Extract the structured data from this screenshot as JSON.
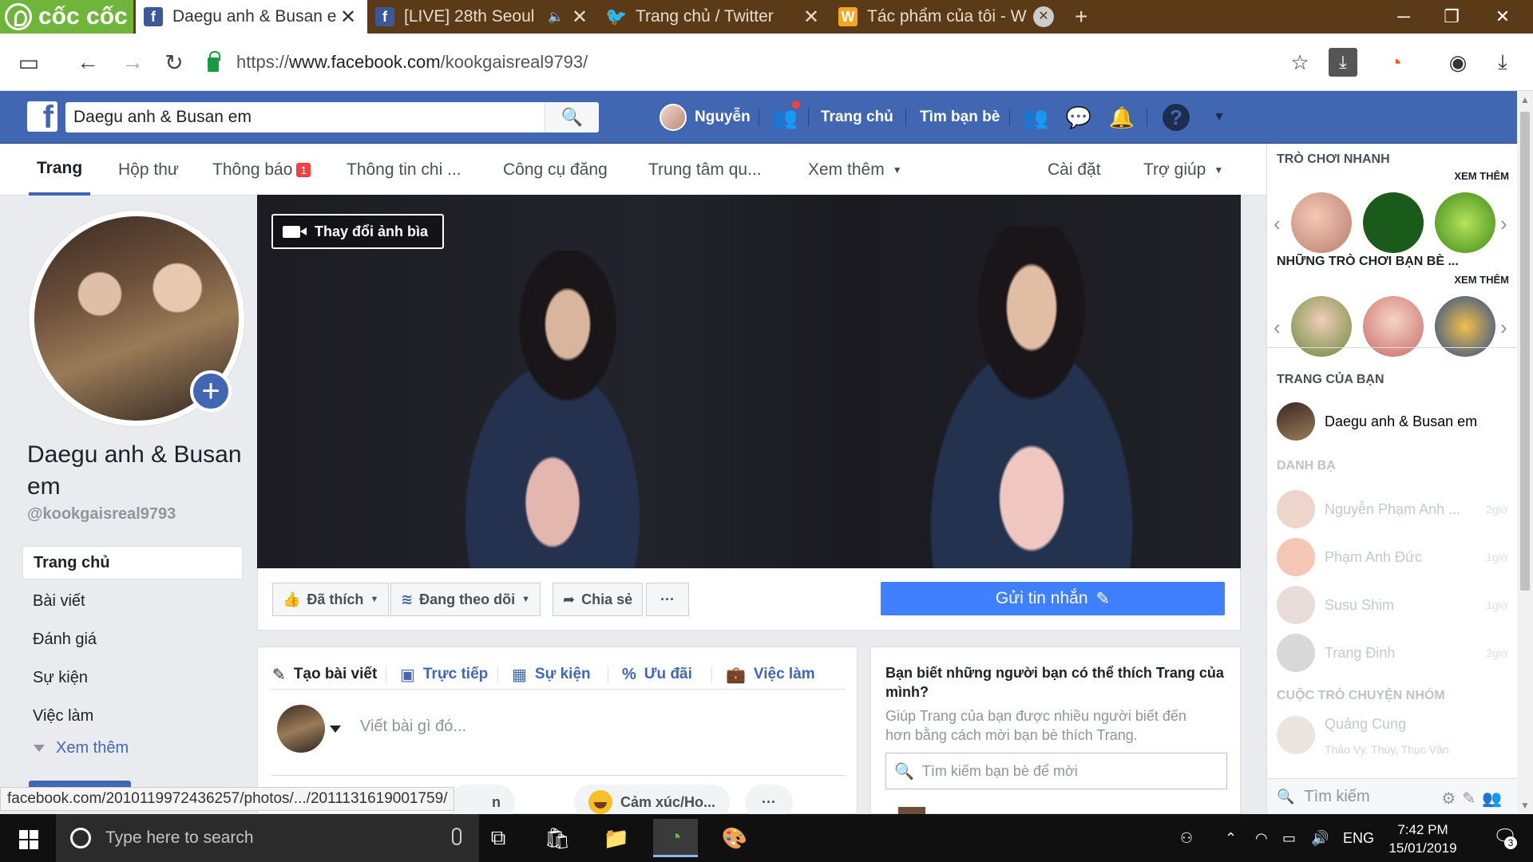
{
  "browser": {
    "brand": "cốc cốc",
    "tabs": [
      {
        "title": "Daegu anh & Busan e",
        "icon": "facebook-icon"
      },
      {
        "title": "[LIVE] 28th Seoul",
        "icon": "facebook-icon"
      },
      {
        "title": "Trang chủ / Twitter",
        "icon": "twitter-icon"
      },
      {
        "title": "Tác phẩm của tôi - W",
        "icon": "wattpad-icon"
      }
    ],
    "url_prefix": "https://",
    "url_host": "www.facebook.com",
    "url_path": "/kookgaisreal9793/",
    "status_url": "facebook.com/2010119972436257/photos/.../2011131619001759/"
  },
  "fb": {
    "search_value": "Daegu anh & Busan em",
    "user_name": "Nguyễn",
    "nav_home": "Trang chủ",
    "nav_find_friends": "Tìm bạn bè"
  },
  "page_tabs": {
    "page": "Trang",
    "inbox": "Hộp thư",
    "notifications": "Thông báo",
    "notifications_badge": "1",
    "insights": "Thông tin chi ...",
    "publishing_tools": "Công cụ đăng",
    "ads_center": "Trung tâm qu...",
    "more": "Xem thêm",
    "settings": "Cài đặt",
    "help": "Trợ giúp"
  },
  "page": {
    "name": "Daegu anh & Busan em",
    "handle": "@kookgaisreal9793",
    "left_nav": [
      "Trang chủ",
      "Bài viết",
      "Đánh giá",
      "Sự kiện",
      "Việc làm"
    ],
    "left_more": "Xem thêm",
    "cover_button": "Thay đổi ảnh bìa"
  },
  "actions": {
    "liked": "Đã thích",
    "following": "Đang theo dõi",
    "share": "Chia sẻ",
    "more": "···",
    "send_message": "Gửi tin nhắn"
  },
  "composer": {
    "tabs": [
      "Tạo bài viết",
      "Trực tiếp",
      "Sự kiện",
      "Ưu đãi",
      "Việc làm"
    ],
    "placeholder": "Viết bài gì đó...",
    "chip_partial": "n",
    "chip_feeling": "Cảm xúc/Ho...",
    "chip_more": "···"
  },
  "suggest": {
    "title": "Bạn biết những người bạn có thể thích Trang của mình?",
    "subtitle": "Giúp Trang của bạn được nhiều người biết đến hơn bằng cách mời bạn bè thích Trang.",
    "search_placeholder": "Tìm kiếm bạn bè để mời"
  },
  "sidebar": {
    "quick_games": "TRÒ CHƠI NHANH",
    "see_more": "XEM THÊM",
    "friends_games": "NHỮNG TRÒ CHƠI BẠN BÈ ...",
    "your_pages": "TRANG CỦA BẠN",
    "your_page_name": "Daegu anh & Busan em",
    "contacts_head": "DANH BẠ",
    "contacts": [
      {
        "name": "Nguyễn Phạm Anh ...",
        "time": "2giờ"
      },
      {
        "name": "Phạm Anh Đức",
        "time": "1giờ"
      },
      {
        "name": "Susu Shim",
        "time": "1giờ"
      },
      {
        "name": "Trang Đinh",
        "time": "2giờ"
      }
    ],
    "group_head": "CUỘC TRÒ CHUYỆN NHÓM",
    "group_name": "Quảng Cung",
    "group_members": "Thảo Vy, Thùy, Thục Văn",
    "search_label": "Tìm kiếm"
  },
  "taskbar": {
    "search_placeholder": "Type here to search",
    "lang": "ENG",
    "time": "7:42 PM",
    "date": "15/01/2019",
    "notifications": "3"
  }
}
